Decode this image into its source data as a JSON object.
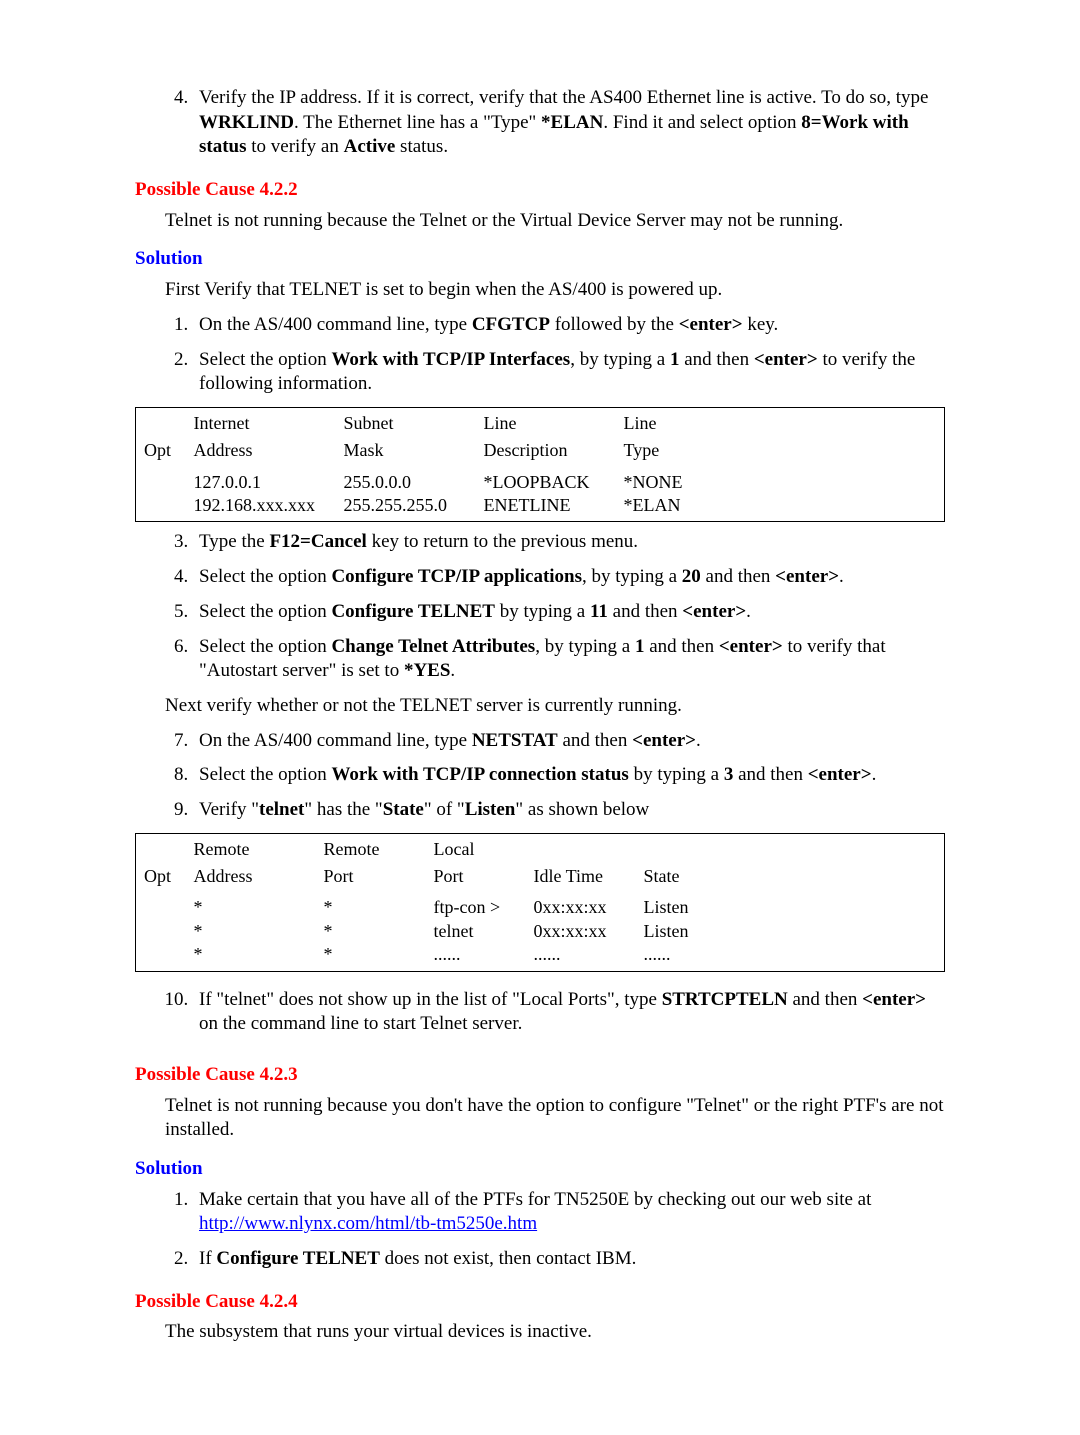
{
  "step4": {
    "num": "4.",
    "text_a": "Verify the IP address.  If it is correct, verify that the AS400 Ethernet line is active. To do so, type ",
    "b1": "WRKLIND",
    "text_b": ".  The Ethernet line has a \"Type\" ",
    "b2": "*ELAN",
    "text_c": ".  Find it and select option ",
    "b3": "8=Work with status",
    "text_d": " to verify an ",
    "b4": "Active",
    "text_e": " status."
  },
  "cause422": {
    "heading": "Possible Cause 4.2.2",
    "body": "Telnet is not running because the Telnet or the Virtual Device Server may not be running."
  },
  "solution1": {
    "heading": "Solution",
    "intro": "First Verify that TELNET is set to begin when the AS/400 is powered up.",
    "li1_a": "On the AS/400 command line, type ",
    "li1_b": "CFGTCP",
    "li1_c": " followed by the ",
    "li1_d": "<enter>",
    "li1_e": " key.",
    "li2_a": "Select the option ",
    "li2_b": "Work with TCP/IP Interfaces",
    "li2_c": ", by typing a ",
    "li2_d": "1",
    "li2_e": " and then ",
    "li2_f": "<enter>",
    "li2_g": " to verify the following information."
  },
  "table1": {
    "h": [
      [
        "",
        "Internet",
        "Subnet",
        "Line",
        "Line"
      ],
      [
        "Opt",
        "Address",
        "Mask",
        "Description",
        "Type"
      ]
    ],
    "r": [
      [
        "",
        "127.0.0.1",
        "255.0.0.0",
        "*LOOPBACK",
        "*NONE"
      ],
      [
        "",
        "192.168.xxx.xxx",
        "255.255.255.0",
        "ENETLINE",
        "*ELAN"
      ]
    ]
  },
  "list2": {
    "li3_a": "Type the ",
    "li3_b": "F12=Cancel",
    "li3_c": " key to return to the previous menu.",
    "li4_a": "Select the option ",
    "li4_b": "Configure TCP/IP applications",
    "li4_c": ", by typing a ",
    "li4_d": "20",
    "li4_e": " and then ",
    "li4_f": "<enter>",
    "li4_g": ".",
    "li5_a": "Select the option ",
    "li5_b": "Configure TELNET",
    "li5_c": " by typing a ",
    "li5_d": "11",
    "li5_e": " and then ",
    "li5_f": "<enter>",
    "li5_g": ".",
    "li6_a": "Select the option ",
    "li6_b": "Change Telnet Attributes",
    "li6_c": ", by typing a ",
    "li6_d": "1",
    "li6_e": " and then ",
    "li6_f": "<enter>",
    "li6_g": " to verify that \"Autostart server\" is set to ",
    "li6_h": "*YES",
    "li6_i": "."
  },
  "next_para": "Next verify whether or not the TELNET server is currently running.",
  "list3": {
    "li7_a": "On the AS/400 command line, type ",
    "li7_b": "NETSTAT",
    "li7_c": " and then ",
    "li7_d": "<enter>",
    "li7_e": ".",
    "li8_a": "Select the option ",
    "li8_b": "Work with TCP/IP connection status",
    "li8_c": " by typing a ",
    "li8_d": "3",
    "li8_e": " and then ",
    "li8_f": "<enter>",
    "li8_g": ".",
    "li9_a": "Verify \"",
    "li9_b": "telnet",
    "li9_c": "\" has the \"",
    "li9_d": "State",
    "li9_e": "\" of \"",
    "li9_f": "Listen",
    "li9_g": "\" as shown below"
  },
  "table2": {
    "h": [
      [
        "",
        "Remote",
        "Remote",
        "Local",
        "",
        ""
      ],
      [
        "Opt",
        "Address",
        "Port",
        "Port",
        "Idle Time",
        "State"
      ]
    ],
    "r": [
      [
        "",
        "*",
        "*",
        "ftp-con >",
        "0xx:xx:xx",
        "Listen"
      ],
      [
        "",
        "*",
        "*",
        "telnet",
        "0xx:xx:xx",
        "Listen"
      ],
      [
        "",
        "*",
        "*",
        "......",
        "......",
        "......"
      ]
    ]
  },
  "list4": {
    "li10_a": "If \"telnet\" does not show up in the list of \"Local Ports\", type ",
    "li10_b": "STRTCPTELN",
    "li10_c": " and then ",
    "li10_d": "<enter>",
    "li10_e": " on the command line to start Telnet server."
  },
  "cause423": {
    "heading": "Possible Cause 4.2.3",
    "body": "Telnet is not running because you don't have the option to configure \"Telnet\" or the right PTF's are not installed."
  },
  "solution2": {
    "heading": "Solution",
    "li1_a": "Make certain that you have all of the PTFs for TN5250E by checking out our web site at ",
    "li1_link": "http://www.nlynx.com/html/tb-tm5250e.htm",
    "li2_a": "If ",
    "li2_b": "Configure TELNET",
    "li2_c": " does not exist, then contact IBM."
  },
  "cause424": {
    "heading": "Possible Cause 4.2.4",
    "body": "The subsystem that runs your virtual devices is inactive."
  }
}
